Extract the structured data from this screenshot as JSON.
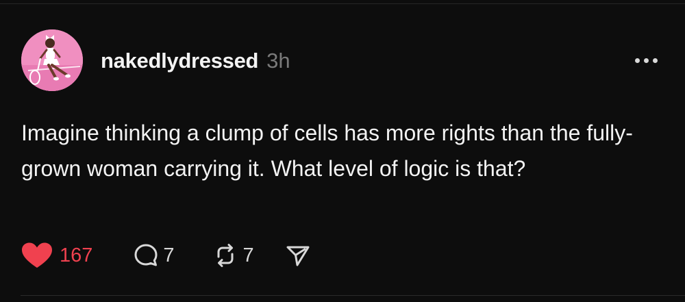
{
  "post": {
    "username": "nakedlydressed",
    "timestamp": "3h",
    "text": "Imagine thinking a clump of cells has more rights than the fully-grown woman carrying it. What level of logic is that?",
    "likes": "167",
    "replies": "7",
    "reposts": "7"
  },
  "icons": {
    "like": "heart-icon",
    "reply": "speech-bubble-icon",
    "repost": "repost-icon",
    "share": "send-icon",
    "more": "more-dots-icon"
  },
  "colors": {
    "background": "#0d0d0d",
    "text": "#f3f3f3",
    "muted": "#7a7a7a",
    "like": "#f0414f",
    "avatar_bg": "#f08fc0"
  }
}
